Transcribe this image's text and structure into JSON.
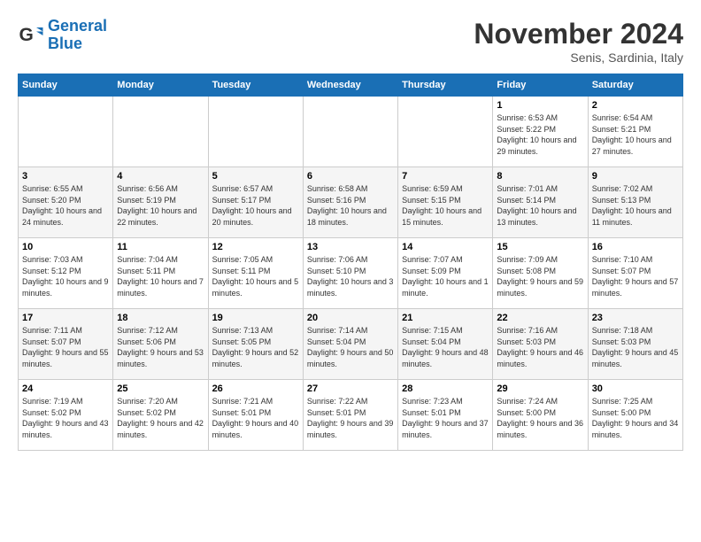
{
  "header": {
    "logo_line1": "General",
    "logo_line2": "Blue",
    "month_title": "November 2024",
    "location": "Senis, Sardinia, Italy"
  },
  "days_of_week": [
    "Sunday",
    "Monday",
    "Tuesday",
    "Wednesday",
    "Thursday",
    "Friday",
    "Saturday"
  ],
  "weeks": [
    [
      {
        "day": "",
        "info": ""
      },
      {
        "day": "",
        "info": ""
      },
      {
        "day": "",
        "info": ""
      },
      {
        "day": "",
        "info": ""
      },
      {
        "day": "",
        "info": ""
      },
      {
        "day": "1",
        "info": "Sunrise: 6:53 AM\nSunset: 5:22 PM\nDaylight: 10 hours and 29 minutes."
      },
      {
        "day": "2",
        "info": "Sunrise: 6:54 AM\nSunset: 5:21 PM\nDaylight: 10 hours and 27 minutes."
      }
    ],
    [
      {
        "day": "3",
        "info": "Sunrise: 6:55 AM\nSunset: 5:20 PM\nDaylight: 10 hours and 24 minutes."
      },
      {
        "day": "4",
        "info": "Sunrise: 6:56 AM\nSunset: 5:19 PM\nDaylight: 10 hours and 22 minutes."
      },
      {
        "day": "5",
        "info": "Sunrise: 6:57 AM\nSunset: 5:17 PM\nDaylight: 10 hours and 20 minutes."
      },
      {
        "day": "6",
        "info": "Sunrise: 6:58 AM\nSunset: 5:16 PM\nDaylight: 10 hours and 18 minutes."
      },
      {
        "day": "7",
        "info": "Sunrise: 6:59 AM\nSunset: 5:15 PM\nDaylight: 10 hours and 15 minutes."
      },
      {
        "day": "8",
        "info": "Sunrise: 7:01 AM\nSunset: 5:14 PM\nDaylight: 10 hours and 13 minutes."
      },
      {
        "day": "9",
        "info": "Sunrise: 7:02 AM\nSunset: 5:13 PM\nDaylight: 10 hours and 11 minutes."
      }
    ],
    [
      {
        "day": "10",
        "info": "Sunrise: 7:03 AM\nSunset: 5:12 PM\nDaylight: 10 hours and 9 minutes."
      },
      {
        "day": "11",
        "info": "Sunrise: 7:04 AM\nSunset: 5:11 PM\nDaylight: 10 hours and 7 minutes."
      },
      {
        "day": "12",
        "info": "Sunrise: 7:05 AM\nSunset: 5:11 PM\nDaylight: 10 hours and 5 minutes."
      },
      {
        "day": "13",
        "info": "Sunrise: 7:06 AM\nSunset: 5:10 PM\nDaylight: 10 hours and 3 minutes."
      },
      {
        "day": "14",
        "info": "Sunrise: 7:07 AM\nSunset: 5:09 PM\nDaylight: 10 hours and 1 minute."
      },
      {
        "day": "15",
        "info": "Sunrise: 7:09 AM\nSunset: 5:08 PM\nDaylight: 9 hours and 59 minutes."
      },
      {
        "day": "16",
        "info": "Sunrise: 7:10 AM\nSunset: 5:07 PM\nDaylight: 9 hours and 57 minutes."
      }
    ],
    [
      {
        "day": "17",
        "info": "Sunrise: 7:11 AM\nSunset: 5:07 PM\nDaylight: 9 hours and 55 minutes."
      },
      {
        "day": "18",
        "info": "Sunrise: 7:12 AM\nSunset: 5:06 PM\nDaylight: 9 hours and 53 minutes."
      },
      {
        "day": "19",
        "info": "Sunrise: 7:13 AM\nSunset: 5:05 PM\nDaylight: 9 hours and 52 minutes."
      },
      {
        "day": "20",
        "info": "Sunrise: 7:14 AM\nSunset: 5:04 PM\nDaylight: 9 hours and 50 minutes."
      },
      {
        "day": "21",
        "info": "Sunrise: 7:15 AM\nSunset: 5:04 PM\nDaylight: 9 hours and 48 minutes."
      },
      {
        "day": "22",
        "info": "Sunrise: 7:16 AM\nSunset: 5:03 PM\nDaylight: 9 hours and 46 minutes."
      },
      {
        "day": "23",
        "info": "Sunrise: 7:18 AM\nSunset: 5:03 PM\nDaylight: 9 hours and 45 minutes."
      }
    ],
    [
      {
        "day": "24",
        "info": "Sunrise: 7:19 AM\nSunset: 5:02 PM\nDaylight: 9 hours and 43 minutes."
      },
      {
        "day": "25",
        "info": "Sunrise: 7:20 AM\nSunset: 5:02 PM\nDaylight: 9 hours and 42 minutes."
      },
      {
        "day": "26",
        "info": "Sunrise: 7:21 AM\nSunset: 5:01 PM\nDaylight: 9 hours and 40 minutes."
      },
      {
        "day": "27",
        "info": "Sunrise: 7:22 AM\nSunset: 5:01 PM\nDaylight: 9 hours and 39 minutes."
      },
      {
        "day": "28",
        "info": "Sunrise: 7:23 AM\nSunset: 5:01 PM\nDaylight: 9 hours and 37 minutes."
      },
      {
        "day": "29",
        "info": "Sunrise: 7:24 AM\nSunset: 5:00 PM\nDaylight: 9 hours and 36 minutes."
      },
      {
        "day": "30",
        "info": "Sunrise: 7:25 AM\nSunset: 5:00 PM\nDaylight: 9 hours and 34 minutes."
      }
    ]
  ]
}
